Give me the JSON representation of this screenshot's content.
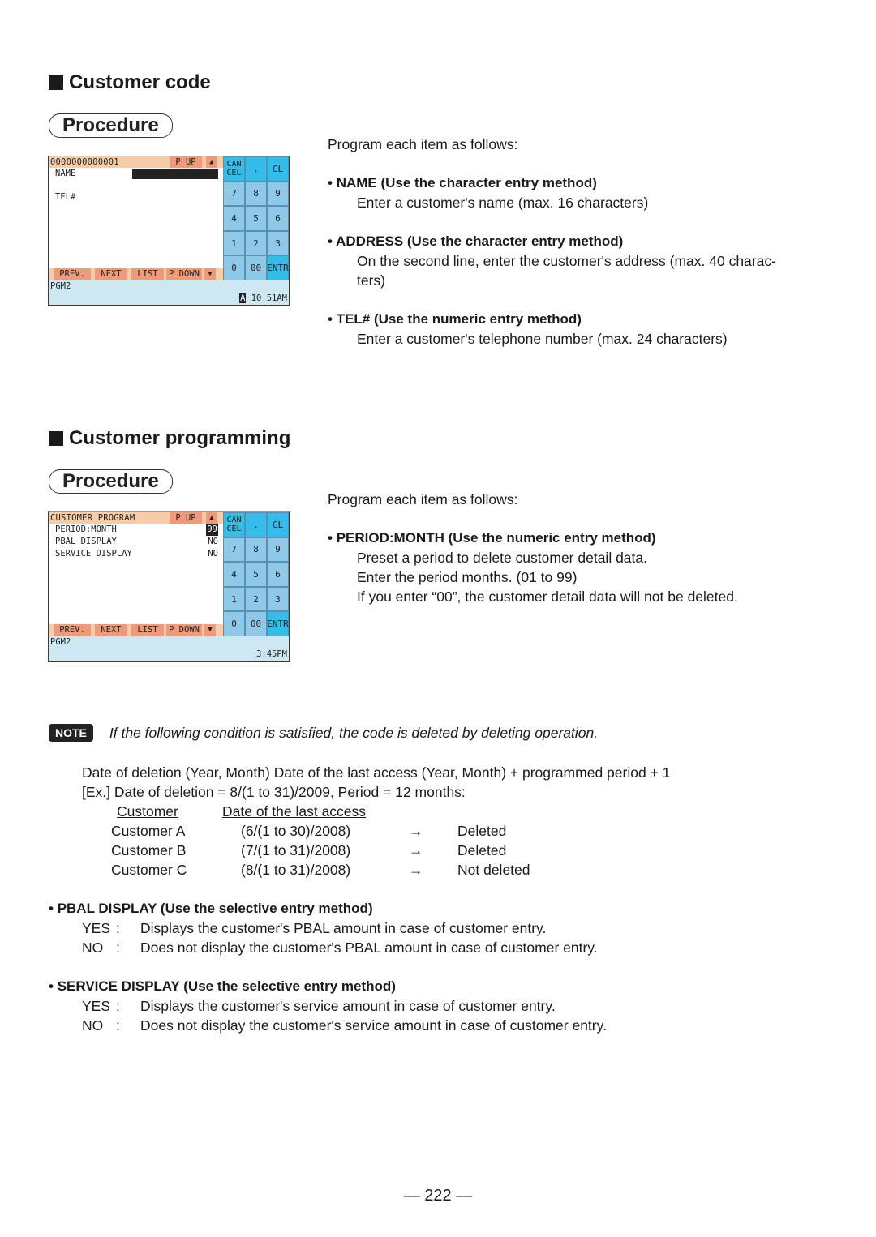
{
  "page_number": "222",
  "sections": {
    "customer_code": {
      "heading": "Customer code",
      "procedure_label": "Procedure",
      "intro": "Program each item as follows:",
      "items": [
        {
          "title": "NAME (Use the character entry method)",
          "lines": [
            "Enter a customer's name (max. 16 characters)"
          ]
        },
        {
          "title": "ADDRESS (Use the character entry method)",
          "lines": [
            "On the second line, enter the customer's address (max. 40 charac-",
            "ters)"
          ]
        },
        {
          "title": "TEL# (Use the numeric entry method)",
          "lines": [
            "Enter a customer's telephone number (max. 24 characters)"
          ]
        }
      ],
      "screen": {
        "title": "0000000000001",
        "page_up": "P UP",
        "page_up_arrow": "▲",
        "fields": [
          "NAME",
          "TEL#"
        ],
        "footer": [
          "PREV.",
          "NEXT",
          "LIST",
          "P DOWN",
          "▼"
        ],
        "status": "PGM2",
        "clock_prefix": "A",
        "clock": "10 51AM",
        "keys": [
          [
            "CAN",
            "CEL"
          ],
          ".",
          "CL",
          "7",
          "8",
          "9",
          "4",
          "5",
          "6",
          "1",
          "2",
          "3",
          "0",
          "00",
          "ENTR"
        ]
      }
    },
    "customer_programming": {
      "heading": "Customer programming",
      "procedure_label": "Procedure",
      "intro": "Program each item as follows:",
      "items": [
        {
          "title": "PERIOD:MONTH (Use the numeric entry method)",
          "lines": [
            "Preset a period to delete customer detail data.",
            "Enter the period months. (01 to 99)",
            "If you enter “00”, the customer detail data will not be deleted."
          ]
        }
      ],
      "screen": {
        "title": "CUSTOMER PROGRAM",
        "page_up": "P UP",
        "page_up_arrow": "▲",
        "rows": [
          {
            "label": "PERIOD:MONTH",
            "value": "99"
          },
          {
            "label": "PBAL DISPLAY",
            "value": "NO"
          },
          {
            "label": "SERVICE DISPLAY",
            "value": "NO"
          }
        ],
        "footer": [
          "PREV.",
          "NEXT",
          "LIST",
          "P DOWN",
          "▼"
        ],
        "status": "PGM2",
        "clock": "3:45PM",
        "keys": [
          [
            "CAN",
            "CEL"
          ],
          ".",
          "CL",
          "7",
          "8",
          "9",
          "4",
          "5",
          "6",
          "1",
          "2",
          "3",
          "0",
          "00",
          "ENTR"
        ]
      }
    }
  },
  "note": {
    "badge": "NOTE",
    "text": "If the following condition is satisfied, the code is deleted by deleting operation.",
    "formula": "Date of deletion (Year, Month) Date of the last access (Year, Month) + programmed period + 1",
    "example": "[Ex.] Date of deletion  = 8/(1 to 31)/2009, Period = 12 months:",
    "table": {
      "headers": [
        "Customer",
        "Date of the last access"
      ],
      "rows": [
        {
          "customer": "Customer A",
          "date": "(6/(1 to 30)/2008)",
          "arrow": "→",
          "result": "Deleted"
        },
        {
          "customer": "Customer B",
          "date": "(7/(1 to 31)/2008)",
          "arrow": "→",
          "result": "Deleted"
        },
        {
          "customer": "Customer C",
          "date": "(8/(1 to 31)/2008)",
          "arrow": "→",
          "result": "Not deleted"
        }
      ]
    }
  },
  "options": [
    {
      "title": "PBAL DISPLAY (Use the selective entry method)",
      "rows": [
        {
          "key": "YES",
          "sep": ":",
          "desc": "Displays the customer's PBAL amount in case of customer entry."
        },
        {
          "key": "NO",
          "sep": ":",
          "desc": "Does not display the customer's PBAL amount in case of customer entry."
        }
      ]
    },
    {
      "title": "SERVICE DISPLAY (Use the selective entry method)",
      "rows": [
        {
          "key": "YES",
          "sep": ":",
          "desc": "Displays the customer's service amount in case of customer entry."
        },
        {
          "key": "NO",
          "sep": ":",
          "desc": "Does not display the customer's service amount in case of customer entry."
        }
      ]
    }
  ]
}
